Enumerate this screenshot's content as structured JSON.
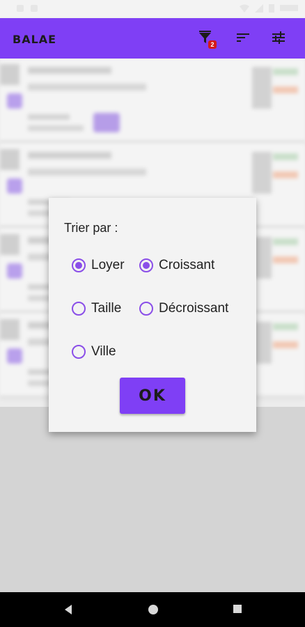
{
  "app_bar": {
    "title": "BALAE",
    "filter_badge": "2",
    "color": "#7f3ff5"
  },
  "icons": {
    "filter": "filter-icon",
    "sort": "sort-icon",
    "tune": "tune-icon"
  },
  "sort_dialog": {
    "title": "Trier par :",
    "criteria": [
      {
        "label": "Loyer",
        "checked": true
      },
      {
        "label": "Taille",
        "checked": false
      },
      {
        "label": "Ville",
        "checked": false
      }
    ],
    "order": [
      {
        "label": "Croissant",
        "checked": true
      },
      {
        "label": "Décroissant",
        "checked": false
      }
    ],
    "ok_label": "OK",
    "accent_color": "#8a4ee8"
  },
  "nav": [
    "back-icon",
    "home-icon",
    "recents-icon"
  ]
}
